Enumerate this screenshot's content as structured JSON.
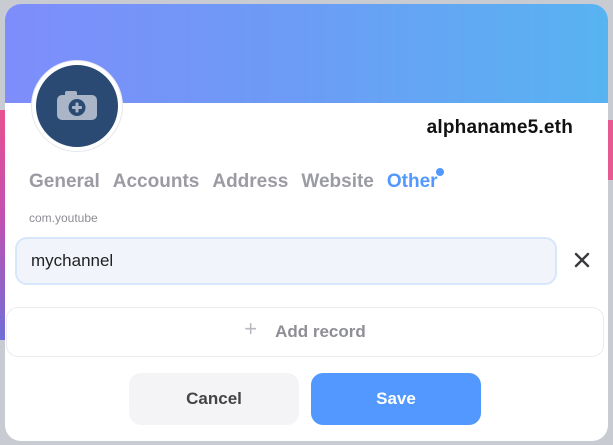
{
  "profile": {
    "name": "alphaname5.eth"
  },
  "avatar": {
    "icon": "camera-plus-icon"
  },
  "tabs": [
    {
      "label": "General"
    },
    {
      "label": "Accounts"
    },
    {
      "label": "Address"
    },
    {
      "label": "Website"
    },
    {
      "label": "Other"
    }
  ],
  "record": {
    "key_label": "com.youtube",
    "value": "mychannel"
  },
  "add_record": {
    "icon": "plus-icon",
    "label": "Add record"
  },
  "actions": {
    "cancel_label": "Cancel",
    "save_label": "Save"
  },
  "colors": {
    "accent": "#5298ff",
    "banner_start": "#7e8dfb",
    "banner_end": "#58b3f1",
    "avatar_bg": "#2b4a73"
  }
}
